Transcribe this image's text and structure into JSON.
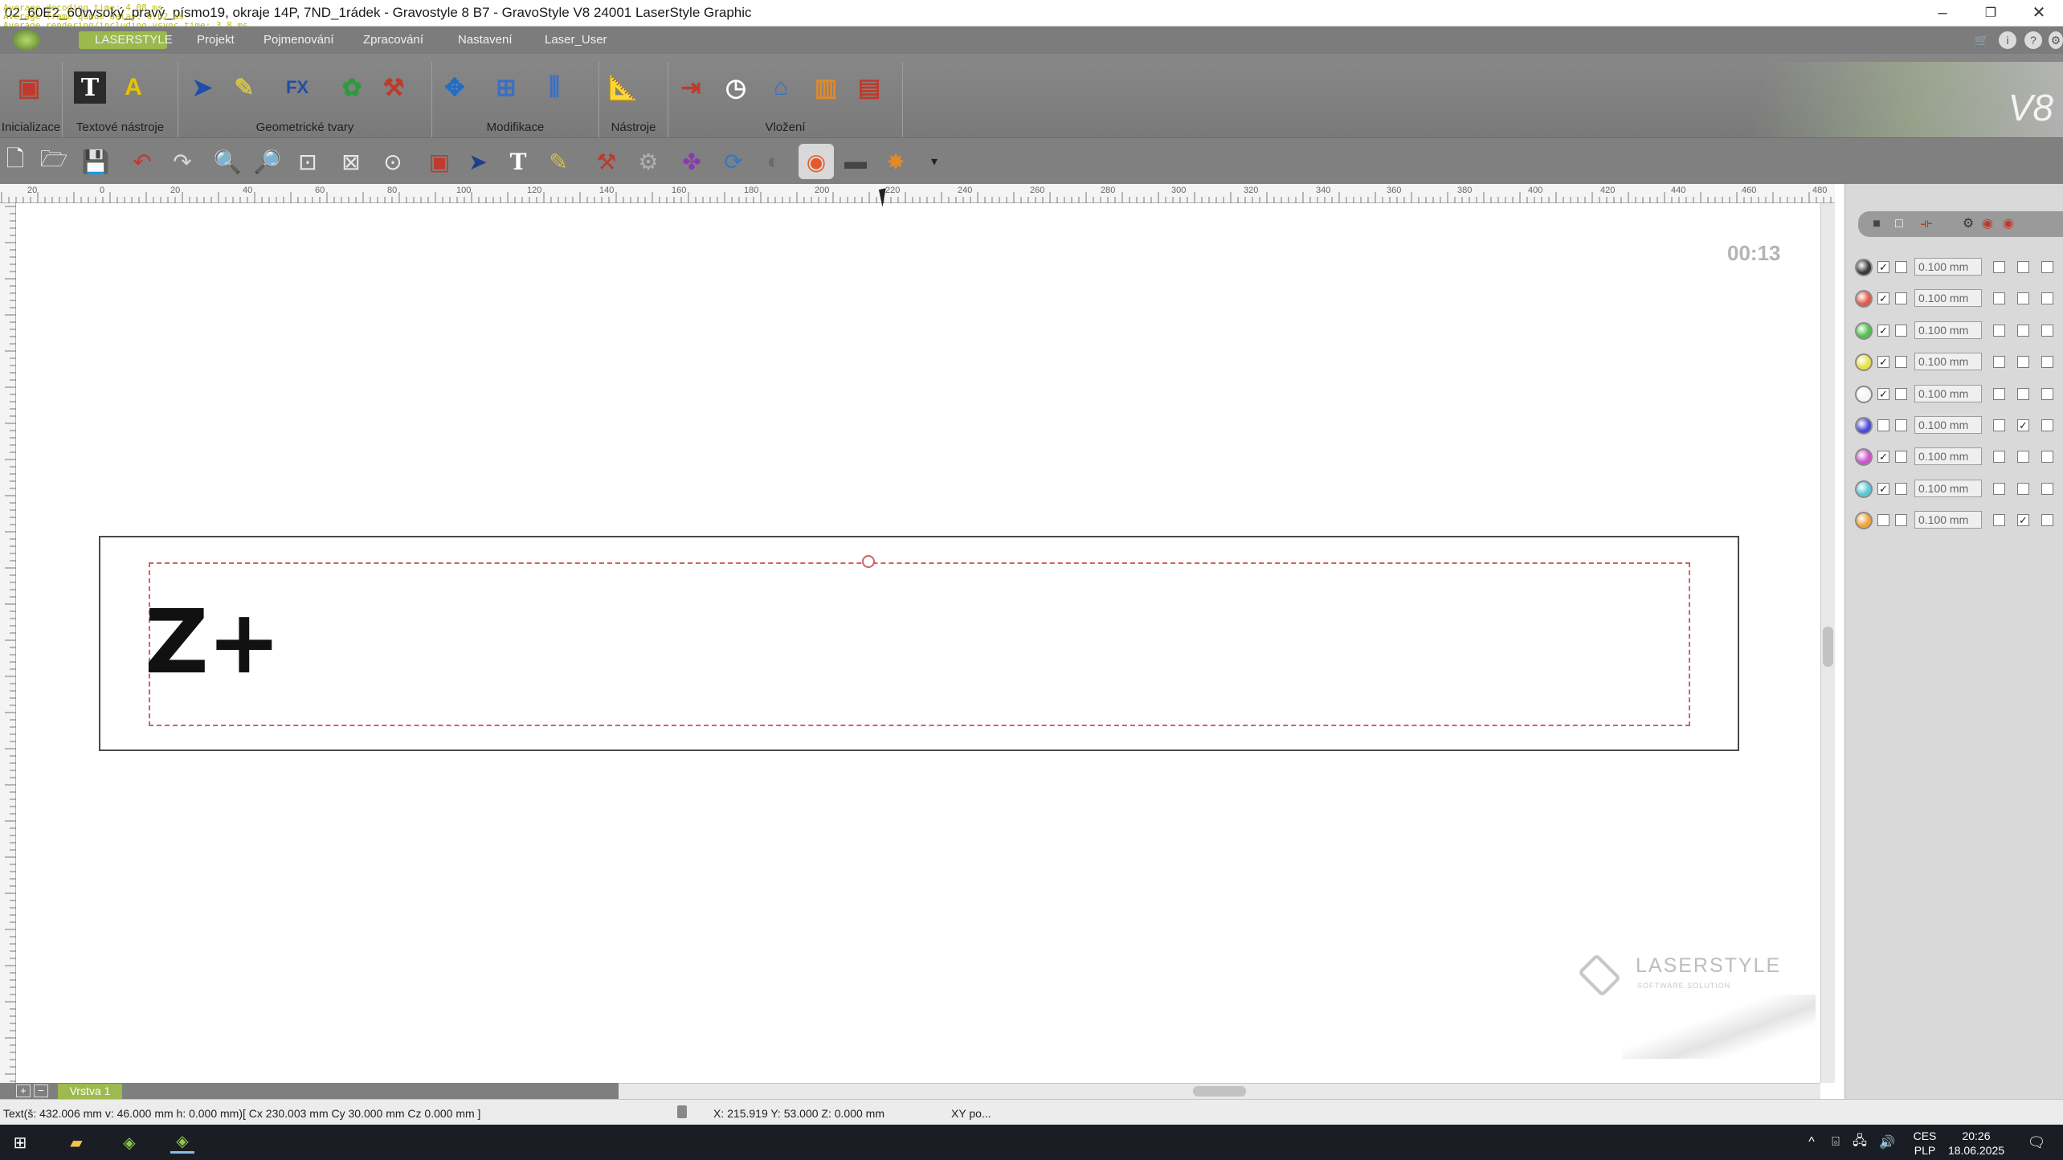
{
  "window": {
    "title": "02_60E2_60vysoký_pravý_písmo19, okraje 14P, 7ND_1rádek - Gravostyle 8 B7 - GravoStyle V8 24001 LaserStyle Graphic",
    "debug_overlay": [
      "Average decoding time: 4.08 ms",
      "Average frame queue delay: 0.02 ms",
      "Average rendering/including vsync time: 3.8 ms"
    ]
  },
  "menu": {
    "items": [
      "LASERSTYLE",
      "Projekt",
      "Pojmenování",
      "Zpracování",
      "Nastavení",
      "Laser_User"
    ]
  },
  "ribbon": {
    "groups": [
      "Inicializace",
      "Textové nástroje",
      "Geometrické tvary",
      "Modifikace",
      "Nástroje",
      "Vložení"
    ],
    "brand": "V8"
  },
  "ruler": {
    "labels": [
      "20",
      "0",
      "20",
      "40",
      "60",
      "80",
      "100",
      "120",
      "140",
      "160",
      "180",
      "200",
      "220",
      "240",
      "260",
      "280",
      "300",
      "320",
      "340",
      "360",
      "380",
      "400",
      "420",
      "440",
      "460",
      "480"
    ]
  },
  "canvas": {
    "timer": "00:13",
    "text": "Z+",
    "watermark_brand": "LASERSTYLE",
    "watermark_sub": "SOFTWARE SOLUTION"
  },
  "layers": {
    "add": "+",
    "remove": "−",
    "active": "Vrstva 1"
  },
  "pens": [
    {
      "color": "#3a3a3a",
      "enabled": true,
      "width": "0.100 mm",
      "c1": false,
      "c2": false,
      "c3": false
    },
    {
      "color": "#e25a4a",
      "enabled": true,
      "width": "0.100 mm",
      "c1": false,
      "c2": false,
      "c3": false
    },
    {
      "color": "#4dc24d",
      "enabled": true,
      "width": "0.100 mm",
      "c1": false,
      "c2": false,
      "c3": false
    },
    {
      "color": "#e7e24a",
      "enabled": true,
      "width": "0.100 mm",
      "c1": false,
      "c2": false,
      "c3": false
    },
    {
      "color": "#f4f4f4",
      "enabled": true,
      "width": "0.100 mm",
      "c1": false,
      "c2": false,
      "c3": false
    },
    {
      "color": "#4a4adb",
      "enabled": false,
      "width": "0.100 mm",
      "c1": false,
      "c2": true,
      "c3": false
    },
    {
      "color": "#cc55cc",
      "enabled": true,
      "width": "0.100 mm",
      "c1": false,
      "c2": false,
      "c3": false
    },
    {
      "color": "#5cc8d6",
      "enabled": true,
      "width": "0.100 mm",
      "c1": false,
      "c2": false,
      "c3": false
    },
    {
      "color": "#f0a23a",
      "enabled": false,
      "width": "0.100 mm",
      "c1": false,
      "c2": true,
      "c3": false
    }
  ],
  "status": {
    "selection": "Text(š: 432.006 mm v: 46.000 mm h: 0.000 mm)[ Cx 230.003 mm  Cy 30.000 mm  Cz 0.000 mm ]",
    "coords": "X: 215.919   Y: 53.000   Z: 0.000 mm",
    "mode": "XY po..."
  },
  "taskbar": {
    "lang": "CES",
    "layout": "PLP",
    "time": "20:26",
    "date": "18.06.2025"
  }
}
